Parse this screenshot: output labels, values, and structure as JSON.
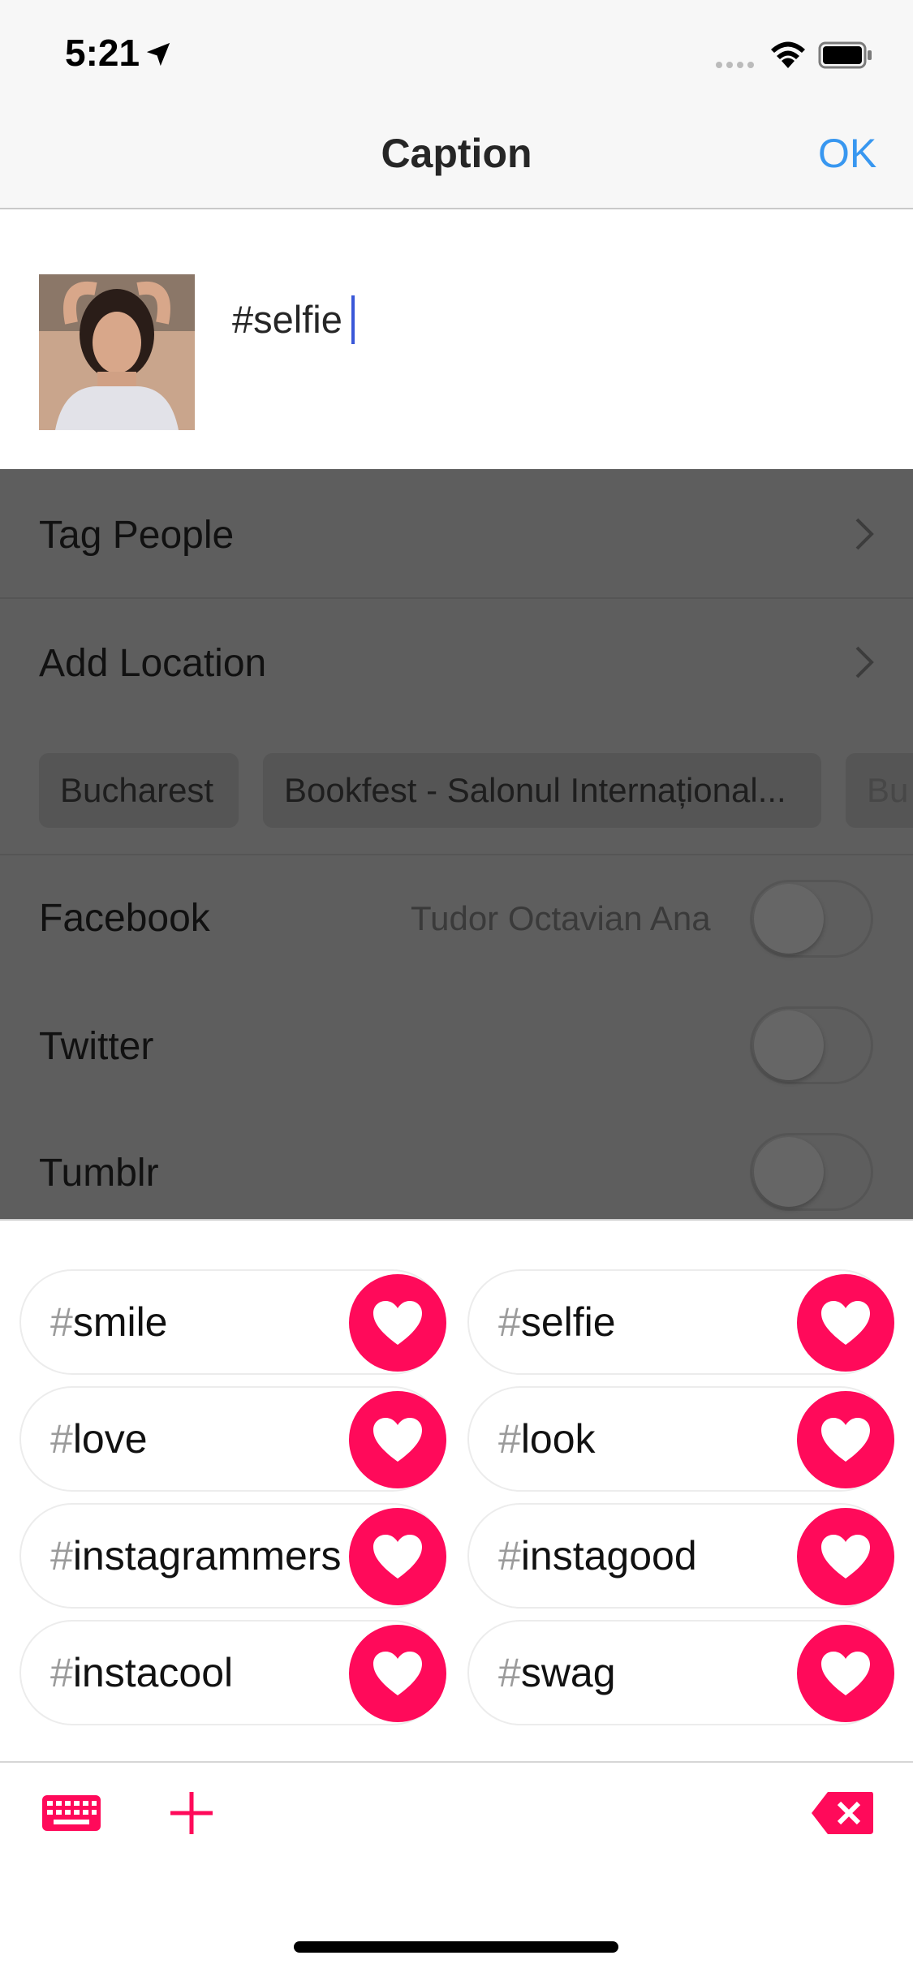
{
  "status_bar": {
    "time": "5:21"
  },
  "nav": {
    "title": "Caption",
    "ok_label": "OK"
  },
  "caption": {
    "value": "#selfie"
  },
  "settings": {
    "tag_people": "Tag People",
    "add_location": "Add Location",
    "location_chips": [
      "Bucharest",
      "Bookfest - Salonul Internațional...",
      "Bu"
    ],
    "facebook": "Facebook",
    "facebook_account": "Tudor Octavian Ana",
    "twitter": "Twitter",
    "tumblr": "Tumblr"
  },
  "hashtags": [
    {
      "hash": "#",
      "tag": "smile"
    },
    {
      "hash": "#",
      "tag": "selfie"
    },
    {
      "hash": "#",
      "tag": "love"
    },
    {
      "hash": "#",
      "tag": "look"
    },
    {
      "hash": "#",
      "tag": "instagrammers"
    },
    {
      "hash": "#",
      "tag": "instagood"
    },
    {
      "hash": "#",
      "tag": "instacool"
    },
    {
      "hash": "#",
      "tag": "swag"
    }
  ],
  "colors": {
    "accent": "#ff0a5a",
    "ok_blue": "#3897f0"
  },
  "icons": [
    "location-arrow-icon",
    "signal-icon",
    "wifi-icon",
    "battery-icon",
    "chevron-right-icon",
    "heart-icon",
    "keyboard-icon",
    "plus-icon",
    "delete-icon"
  ]
}
